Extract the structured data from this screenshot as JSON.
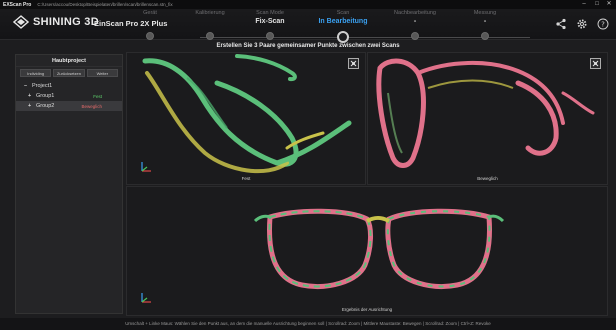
{
  "titlebar": {
    "app_name": "EXScan Pro",
    "path": "C:/Users/accou/Desktop/Beispielaten/brillen/scan/brillenscan.stn_fix",
    "minimize": "–",
    "maximize": "□",
    "close": "✕"
  },
  "header": {
    "brand": "SHINING 3D",
    "device": "EinScan Pro 2X Plus",
    "steps": [
      {
        "label": "Gerät",
        "value": ""
      },
      {
        "label": "Kalibrierung",
        "value": ""
      },
      {
        "label": "Scan Mode",
        "value": "Fix-Scan"
      },
      {
        "label": "Scan",
        "value": "In Bearbeitung"
      },
      {
        "label": "Nachbearbeitung",
        "value": "-"
      },
      {
        "label": "Messung",
        "value": "-"
      }
    ],
    "icons": [
      "share-icon",
      "settings-icon",
      "help-icon"
    ]
  },
  "instruction": "Erstellen Sie 3 Paare gemeinsamer Punkte zwischen zwei Scans",
  "panel": {
    "title": "Haubtproject",
    "buttons": [
      "Individing",
      "Zurücksetzen",
      "Weiter"
    ],
    "tree": [
      {
        "toggle": "–",
        "name": "Project1",
        "status": ""
      },
      {
        "toggle": "+",
        "name": "Group1",
        "status": "Fest"
      },
      {
        "toggle": "+",
        "name": "Group2",
        "status": "Beweglich"
      }
    ]
  },
  "viewports": {
    "fixed_label": "Fest",
    "moving_label": "Beweglich",
    "result_label": "Ergebnis der Ausrichtung"
  },
  "colors": {
    "accent": "#3aa0f0",
    "fixed_scan": "#5bbf7a",
    "moving_scan": "#e0718a",
    "highlight": "#c9c24a"
  },
  "status": "Umschalt + Linke Maus: Wählen Sie den Punkt aus, an dem die manuelle Ausrichtung beginnen soll | Scrollrad: Zoom | Mittlere Maustaste: Bewegen | Scrollrad: Zoom | Ctrl+Z: Revoke"
}
